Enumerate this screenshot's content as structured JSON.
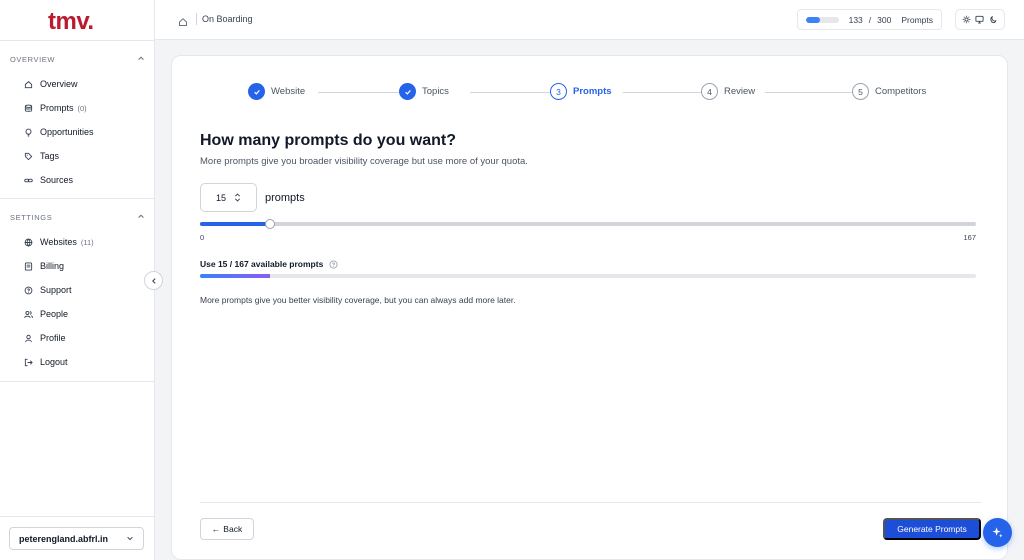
{
  "brand": {
    "logo_text": "tmv",
    "logo_dot": ".",
    "color": "#b91c2e"
  },
  "sidebar": {
    "sections": [
      {
        "title": "OVERVIEW",
        "items": [
          {
            "label": "Overview",
            "icon": "home-icon"
          },
          {
            "label": "Prompts",
            "count": "(0)",
            "icon": "database-icon"
          },
          {
            "label": "Opportunities",
            "icon": "lightbulb-icon"
          },
          {
            "label": "Tags",
            "icon": "tag-icon"
          },
          {
            "label": "Sources",
            "icon": "link-icon"
          }
        ]
      },
      {
        "title": "SETTINGS",
        "items": [
          {
            "label": "Websites",
            "count": "(11)",
            "icon": "globe-icon"
          },
          {
            "label": "Billing",
            "icon": "billing-icon"
          },
          {
            "label": "Support",
            "icon": "support-icon"
          },
          {
            "label": "People",
            "icon": "people-icon"
          },
          {
            "label": "Profile",
            "icon": "user-icon"
          },
          {
            "label": "Logout",
            "icon": "logout-icon"
          }
        ]
      }
    ],
    "site_selector": {
      "value": "peterengland.abfrl.in"
    }
  },
  "topbar": {
    "breadcrumb": "On Boarding",
    "quota": {
      "used": "133",
      "separator": "/",
      "total": "300",
      "label": "Prompts",
      "fraction": 0.443
    }
  },
  "stepper": {
    "steps": [
      {
        "number": "1",
        "label": "Website",
        "state": "done"
      },
      {
        "number": "2",
        "label": "Topics",
        "state": "done"
      },
      {
        "number": "3",
        "label": "Prompts",
        "state": "current"
      },
      {
        "number": "4",
        "label": "Review",
        "state": "todo"
      },
      {
        "number": "5",
        "label": "Competitors",
        "state": "todo"
      }
    ]
  },
  "main": {
    "title": "How many prompts do you want?",
    "subtitle": "More prompts give you broader visibility coverage but use more of your quota.",
    "count_value": "15",
    "count_label": "prompts",
    "slider": {
      "min": "0",
      "max": "167",
      "value": 15
    },
    "usage_label": "Use 15 / 167 available prompts",
    "usage_fraction": 0.0898,
    "note": "More prompts give you better visibility coverage, but you can always add more later."
  },
  "footer": {
    "back_label": "Back",
    "back_arrow": "←",
    "generate_label": "Generate Prompts"
  },
  "colors": {
    "accent": "#2563eb",
    "brand": "#b91c2e"
  }
}
